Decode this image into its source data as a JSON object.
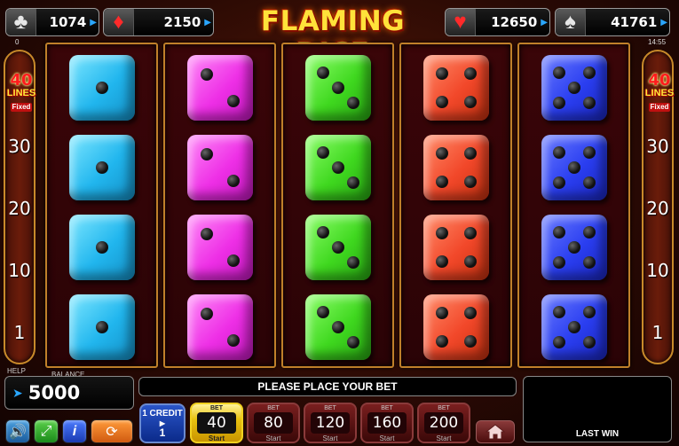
{
  "jackpots": [
    {
      "suit": "club-icon",
      "glyph": "♣",
      "amount": "1074",
      "color": "white"
    },
    {
      "suit": "diamond-icon",
      "glyph": "♦",
      "amount": "2150",
      "color": "red"
    },
    {
      "suit": "heart-icon",
      "glyph": "♥",
      "amount": "12650",
      "color": "red"
    },
    {
      "suit": "spade-icon",
      "glyph": "♠",
      "amount": "41761",
      "color": "white"
    }
  ],
  "title": "FLAMING DICE",
  "small_left": "0",
  "clock": "14:55",
  "lines": {
    "count": "40",
    "label": "LINES",
    "fixed": "Fixed",
    "markers": [
      "30",
      "20",
      "10",
      "1"
    ]
  },
  "reels": [
    {
      "color": "cyan",
      "faces": [
        1,
        1,
        1,
        1
      ]
    },
    {
      "color": "magenta",
      "faces": [
        2,
        2,
        2,
        2
      ]
    },
    {
      "color": "green",
      "faces": [
        3,
        3,
        3,
        3
      ]
    },
    {
      "color": "red",
      "faces": [
        4,
        4,
        4,
        4
      ]
    },
    {
      "color": "blue",
      "faces": [
        5,
        5,
        5,
        5
      ]
    }
  ],
  "help_label": "HELP",
  "balance": {
    "label": "BALANCE",
    "value": "5000"
  },
  "message": "PLEASE PLACE YOUR BET",
  "last_win": {
    "label": "LAST WIN",
    "value": ""
  },
  "credit": {
    "line1": "1 CREDIT",
    "value": "1"
  },
  "bets": [
    {
      "caption": "BET",
      "value": "40",
      "start": "Start",
      "active": true
    },
    {
      "caption": "BET",
      "value": "80",
      "start": "Start",
      "active": false
    },
    {
      "caption": "BET",
      "value": "120",
      "start": "Start",
      "active": false
    },
    {
      "caption": "BET",
      "value": "160",
      "start": "Start",
      "active": false
    },
    {
      "caption": "BET",
      "value": "200",
      "start": "Start",
      "active": false
    }
  ],
  "icons": {
    "sound": "speaker-icon",
    "fullscreen": "fullscreen-icon",
    "info": "info-icon",
    "gamble": "gamble-icon",
    "home": "home-icon"
  },
  "colors": {
    "title": "#ffe23a",
    "accent_blue": "#2aa7ff",
    "bet_active": "#e8c210"
  }
}
